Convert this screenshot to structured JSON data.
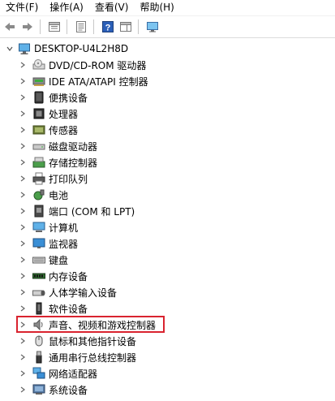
{
  "menu": {
    "file": "文件(F)",
    "action": "操作(A)",
    "view": "查看(V)",
    "help": "帮助(H)"
  },
  "toolbar": {
    "buttons": [
      "back-arrow-icon",
      "forward-arrow-icon",
      "console-tree-icon",
      "properties-icon",
      "help-icon",
      "show-hide-pane-icon",
      "monitor-icon"
    ]
  },
  "tree": {
    "root_label": "DESKTOP-U4L2H8D",
    "categories": [
      {
        "label": "DVD/CD-ROM 驱动器",
        "icon": "dvd-drive-icon"
      },
      {
        "label": "IDE ATA/ATAPI 控制器",
        "icon": "ide-controller-icon"
      },
      {
        "label": "便携设备",
        "icon": "portable-device-icon"
      },
      {
        "label": "处理器",
        "icon": "processor-icon"
      },
      {
        "label": "传感器",
        "icon": "sensor-icon"
      },
      {
        "label": "磁盘驱动器",
        "icon": "disk-drive-icon"
      },
      {
        "label": "存储控制器",
        "icon": "storage-controller-icon"
      },
      {
        "label": "打印队列",
        "icon": "print-queue-icon"
      },
      {
        "label": "电池",
        "icon": "battery-icon"
      },
      {
        "label": "端口 (COM 和 LPT)",
        "icon": "port-icon"
      },
      {
        "label": "计算机",
        "icon": "computer-icon"
      },
      {
        "label": "监视器",
        "icon": "monitor-icon"
      },
      {
        "label": "键盘",
        "icon": "keyboard-icon"
      },
      {
        "label": "内存设备",
        "icon": "memory-device-icon"
      },
      {
        "label": "人体学输入设备",
        "icon": "hid-icon"
      },
      {
        "label": "软件设备",
        "icon": "software-device-icon"
      },
      {
        "label": "声音、视频和游戏控制器",
        "icon": "speaker-icon",
        "highlighted": true
      },
      {
        "label": "鼠标和其他指针设备",
        "icon": "mouse-icon"
      },
      {
        "label": "通用串行总线控制器",
        "icon": "usb-icon"
      },
      {
        "label": "网络适配器",
        "icon": "network-adapter-icon"
      },
      {
        "label": "系统设备",
        "icon": "system-device-icon"
      }
    ]
  },
  "colors": {
    "highlight_border": "#d9232f"
  }
}
